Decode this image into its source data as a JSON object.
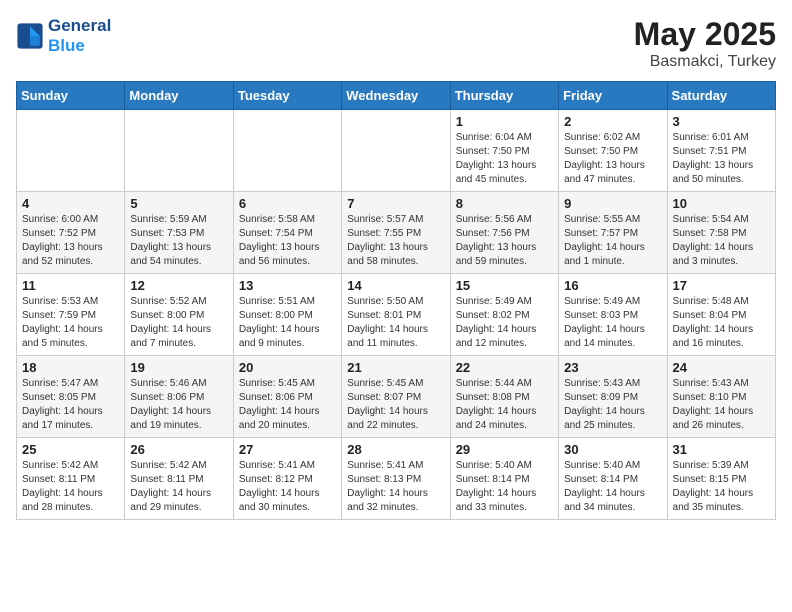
{
  "header": {
    "logo_line1": "General",
    "logo_line2": "Blue",
    "month": "May 2025",
    "location": "Basmakci, Turkey"
  },
  "weekdays": [
    "Sunday",
    "Monday",
    "Tuesday",
    "Wednesday",
    "Thursday",
    "Friday",
    "Saturday"
  ],
  "weeks": [
    [
      {
        "day": "",
        "info": ""
      },
      {
        "day": "",
        "info": ""
      },
      {
        "day": "",
        "info": ""
      },
      {
        "day": "",
        "info": ""
      },
      {
        "day": "1",
        "info": "Sunrise: 6:04 AM\nSunset: 7:50 PM\nDaylight: 13 hours\nand 45 minutes."
      },
      {
        "day": "2",
        "info": "Sunrise: 6:02 AM\nSunset: 7:50 PM\nDaylight: 13 hours\nand 47 minutes."
      },
      {
        "day": "3",
        "info": "Sunrise: 6:01 AM\nSunset: 7:51 PM\nDaylight: 13 hours\nand 50 minutes."
      }
    ],
    [
      {
        "day": "4",
        "info": "Sunrise: 6:00 AM\nSunset: 7:52 PM\nDaylight: 13 hours\nand 52 minutes."
      },
      {
        "day": "5",
        "info": "Sunrise: 5:59 AM\nSunset: 7:53 PM\nDaylight: 13 hours\nand 54 minutes."
      },
      {
        "day": "6",
        "info": "Sunrise: 5:58 AM\nSunset: 7:54 PM\nDaylight: 13 hours\nand 56 minutes."
      },
      {
        "day": "7",
        "info": "Sunrise: 5:57 AM\nSunset: 7:55 PM\nDaylight: 13 hours\nand 58 minutes."
      },
      {
        "day": "8",
        "info": "Sunrise: 5:56 AM\nSunset: 7:56 PM\nDaylight: 13 hours\nand 59 minutes."
      },
      {
        "day": "9",
        "info": "Sunrise: 5:55 AM\nSunset: 7:57 PM\nDaylight: 14 hours\nand 1 minute."
      },
      {
        "day": "10",
        "info": "Sunrise: 5:54 AM\nSunset: 7:58 PM\nDaylight: 14 hours\nand 3 minutes."
      }
    ],
    [
      {
        "day": "11",
        "info": "Sunrise: 5:53 AM\nSunset: 7:59 PM\nDaylight: 14 hours\nand 5 minutes."
      },
      {
        "day": "12",
        "info": "Sunrise: 5:52 AM\nSunset: 8:00 PM\nDaylight: 14 hours\nand 7 minutes."
      },
      {
        "day": "13",
        "info": "Sunrise: 5:51 AM\nSunset: 8:00 PM\nDaylight: 14 hours\nand 9 minutes."
      },
      {
        "day": "14",
        "info": "Sunrise: 5:50 AM\nSunset: 8:01 PM\nDaylight: 14 hours\nand 11 minutes."
      },
      {
        "day": "15",
        "info": "Sunrise: 5:49 AM\nSunset: 8:02 PM\nDaylight: 14 hours\nand 12 minutes."
      },
      {
        "day": "16",
        "info": "Sunrise: 5:49 AM\nSunset: 8:03 PM\nDaylight: 14 hours\nand 14 minutes."
      },
      {
        "day": "17",
        "info": "Sunrise: 5:48 AM\nSunset: 8:04 PM\nDaylight: 14 hours\nand 16 minutes."
      }
    ],
    [
      {
        "day": "18",
        "info": "Sunrise: 5:47 AM\nSunset: 8:05 PM\nDaylight: 14 hours\nand 17 minutes."
      },
      {
        "day": "19",
        "info": "Sunrise: 5:46 AM\nSunset: 8:06 PM\nDaylight: 14 hours\nand 19 minutes."
      },
      {
        "day": "20",
        "info": "Sunrise: 5:45 AM\nSunset: 8:06 PM\nDaylight: 14 hours\nand 20 minutes."
      },
      {
        "day": "21",
        "info": "Sunrise: 5:45 AM\nSunset: 8:07 PM\nDaylight: 14 hours\nand 22 minutes."
      },
      {
        "day": "22",
        "info": "Sunrise: 5:44 AM\nSunset: 8:08 PM\nDaylight: 14 hours\nand 24 minutes."
      },
      {
        "day": "23",
        "info": "Sunrise: 5:43 AM\nSunset: 8:09 PM\nDaylight: 14 hours\nand 25 minutes."
      },
      {
        "day": "24",
        "info": "Sunrise: 5:43 AM\nSunset: 8:10 PM\nDaylight: 14 hours\nand 26 minutes."
      }
    ],
    [
      {
        "day": "25",
        "info": "Sunrise: 5:42 AM\nSunset: 8:11 PM\nDaylight: 14 hours\nand 28 minutes."
      },
      {
        "day": "26",
        "info": "Sunrise: 5:42 AM\nSunset: 8:11 PM\nDaylight: 14 hours\nand 29 minutes."
      },
      {
        "day": "27",
        "info": "Sunrise: 5:41 AM\nSunset: 8:12 PM\nDaylight: 14 hours\nand 30 minutes."
      },
      {
        "day": "28",
        "info": "Sunrise: 5:41 AM\nSunset: 8:13 PM\nDaylight: 14 hours\nand 32 minutes."
      },
      {
        "day": "29",
        "info": "Sunrise: 5:40 AM\nSunset: 8:14 PM\nDaylight: 14 hours\nand 33 minutes."
      },
      {
        "day": "30",
        "info": "Sunrise: 5:40 AM\nSunset: 8:14 PM\nDaylight: 14 hours\nand 34 minutes."
      },
      {
        "day": "31",
        "info": "Sunrise: 5:39 AM\nSunset: 8:15 PM\nDaylight: 14 hours\nand 35 minutes."
      }
    ]
  ]
}
